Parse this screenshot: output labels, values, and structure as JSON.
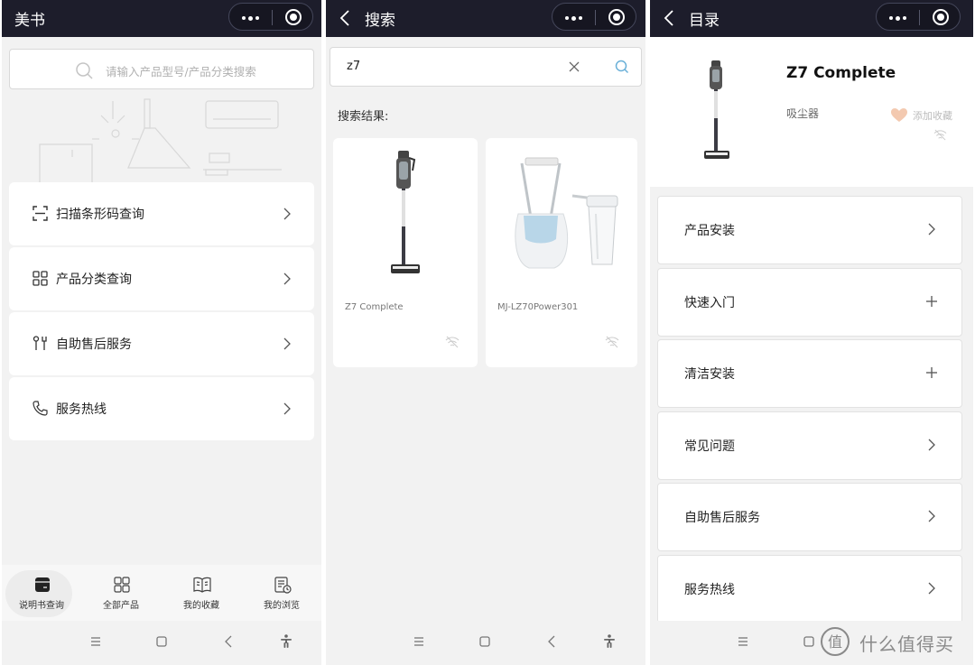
{
  "panel1": {
    "title": "美书",
    "search_placeholder": "请输入产品型号/产品分类搜索",
    "menu": [
      {
        "label": "扫描条形码查询",
        "icon": "scan-icon"
      },
      {
        "label": "产品分类查询",
        "icon": "grid-icon"
      },
      {
        "label": "自助售后服务",
        "icon": "tools-icon"
      },
      {
        "label": "服务热线",
        "icon": "phone-icon"
      }
    ],
    "tabs": [
      {
        "label": "说明书查询",
        "icon": "manual-icon",
        "active": true
      },
      {
        "label": "全部产品",
        "icon": "grid-icon",
        "active": false
      },
      {
        "label": "我的收藏",
        "icon": "book-icon",
        "active": false
      },
      {
        "label": "我的浏览",
        "icon": "history-icon",
        "active": false
      }
    ]
  },
  "panel2": {
    "title": "搜索",
    "query": "z7",
    "results_label": "搜索结果:",
    "results": [
      {
        "name": "Z7 Complete"
      },
      {
        "name": "MJ-LZ70Power301"
      }
    ]
  },
  "panel3": {
    "title": "目录",
    "product_name": "Z7 Complete",
    "product_category": "吸尘器",
    "favorite_label": "添加收藏",
    "rows": [
      {
        "label": "产品安装",
        "icon": "chevron-right-icon"
      },
      {
        "label": "快速入门",
        "icon": "plus-icon"
      },
      {
        "label": "清洁安装",
        "icon": "plus-icon"
      },
      {
        "label": "常见问题",
        "icon": "chevron-right-icon"
      },
      {
        "label": "自助售后服务",
        "icon": "chevron-right-icon"
      },
      {
        "label": "服务热线",
        "icon": "chevron-right-icon"
      }
    ]
  },
  "watermark": {
    "text": "值 | 什么值得买"
  },
  "colors": {
    "titlebar": "#1d1d2b",
    "background": "#f2f2f2",
    "card": "#ffffff",
    "heart": "#f3c9b0",
    "search_accent": "#6ab0d8"
  }
}
